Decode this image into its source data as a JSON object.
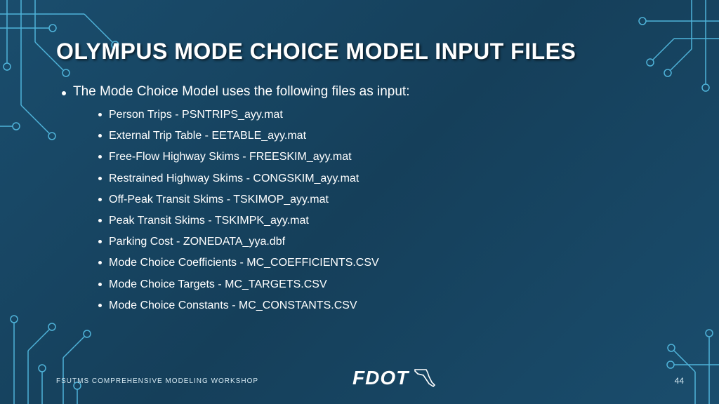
{
  "title": "OLYMPUS MODE CHOICE MODEL INPUT FILES",
  "intro": "The Mode Choice Model uses the following files as input:",
  "items": [
    "Person Trips - PSNTRIPS_ayy.mat",
    "External Trip Table - EETABLE_ayy.mat",
    "Free-Flow Highway Skims - FREESKIM_ayy.mat",
    "Restrained Highway Skims - CONGSKIM_ayy.mat",
    "Off-Peak Transit Skims - TSKIMOP_ayy.mat",
    "Peak Transit Skims - TSKIMPK_ayy.mat",
    "Parking Cost - ZONEDATA_yya.dbf",
    "Mode Choice Coefficients - MC_COEFFICIENTS.CSV",
    "Mode Choice Targets - MC_TARGETS.CSV",
    "Mode Choice Constants - MC_CONSTANTS.CSV"
  ],
  "footer_label": "FSUTMS COMPREHENSIVE MODELING WORKSHOP",
  "logo_text": "FDOT",
  "page_number": "44"
}
